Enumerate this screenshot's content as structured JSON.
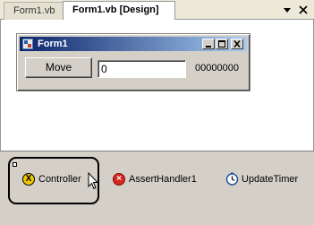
{
  "tabs": [
    {
      "label": "Form1.vb",
      "active": false
    },
    {
      "label": "Form1.vb [Design]",
      "active": true
    }
  ],
  "tabstrip": {
    "dropdown_icon": "chevron-down-icon",
    "close_icon": "close-icon"
  },
  "form": {
    "title": "Form1",
    "buttons": {
      "minimize": "_",
      "maximize": "□",
      "close": "×"
    },
    "move_button_label": "Move",
    "text_value": "0",
    "label_value": "00000000"
  },
  "tray": {
    "components": [
      {
        "name": "Controller",
        "icon": "x-badge-icon",
        "selected": true
      },
      {
        "name": "AssertHandler1",
        "icon": "error-icon",
        "selected": false
      },
      {
        "name": "UpdateTimer",
        "icon": "timer-icon",
        "selected": false
      }
    ]
  },
  "colors": {
    "titlebar_start": "#0a246a",
    "titlebar_end": "#a6caf0",
    "surface": "#ffffff",
    "tray": "#d4d0c8"
  }
}
